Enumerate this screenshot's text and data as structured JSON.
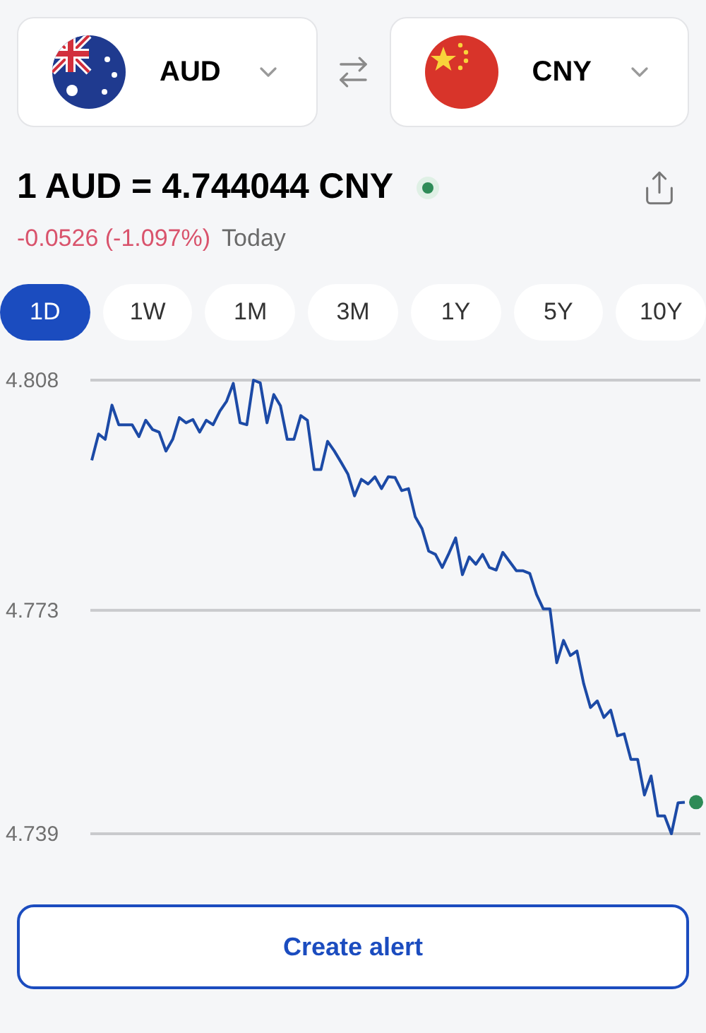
{
  "selectors": [
    {
      "code": "AUD",
      "kind": "au"
    },
    {
      "code": "CNY",
      "kind": "cn"
    }
  ],
  "rate": {
    "text": "1 AUD = 4.744044 CNY",
    "live": true
  },
  "change": {
    "value": "-0.0526 (-1.097%)",
    "period": "Today"
  },
  "ranges": [
    {
      "label": "1D",
      "selected": true
    },
    {
      "label": "1W",
      "selected": false
    },
    {
      "label": "1M",
      "selected": false
    },
    {
      "label": "3M",
      "selected": false
    },
    {
      "label": "1Y",
      "selected": false
    },
    {
      "label": "5Y",
      "selected": false
    },
    {
      "label": "10Y",
      "selected": false
    }
  ],
  "chart_data": {
    "type": "line",
    "grid": true,
    "ylim": [
      4.739,
      4.808
    ],
    "yticks": [
      4.808,
      4.773,
      4.739
    ],
    "series": [
      {
        "color": "#1c4aa6",
        "values": [
          4.7958,
          4.7998,
          4.799,
          4.8042,
          4.8012,
          4.8012,
          4.8012,
          4.7994,
          4.8019,
          4.8005,
          4.8001,
          4.7972,
          4.799,
          4.8023,
          4.8015,
          4.802,
          4.8001,
          4.8019,
          4.8012,
          4.8033,
          4.8048,
          4.8075,
          4.8015,
          4.8012,
          4.808,
          4.8076,
          4.8015,
          4.8058,
          4.8041,
          4.799,
          4.799,
          4.8026,
          4.8019,
          4.7944,
          4.7944,
          4.7987,
          4.7972,
          4.7955,
          4.7937,
          4.7904,
          4.7929,
          4.7922,
          4.7933,
          4.7915,
          4.7933,
          4.7932,
          4.7912,
          4.7915,
          4.7872,
          4.7854,
          4.782,
          4.7815,
          4.7795,
          4.7817,
          4.784,
          4.7784,
          4.7811,
          4.78,
          4.7815,
          4.7795,
          4.7791,
          4.7818,
          4.7804,
          4.779,
          4.779,
          4.7786,
          4.7754,
          4.7732,
          4.7732,
          4.765,
          4.7684,
          4.7661,
          4.7668,
          4.7618,
          4.7582,
          4.7592,
          4.7567,
          4.7578,
          4.7539,
          4.7542,
          4.7503,
          4.7503,
          4.7449,
          4.7478,
          4.7417,
          4.7417,
          4.739,
          4.7437,
          4.7438
        ]
      }
    ]
  },
  "alert_button": "Create alert"
}
